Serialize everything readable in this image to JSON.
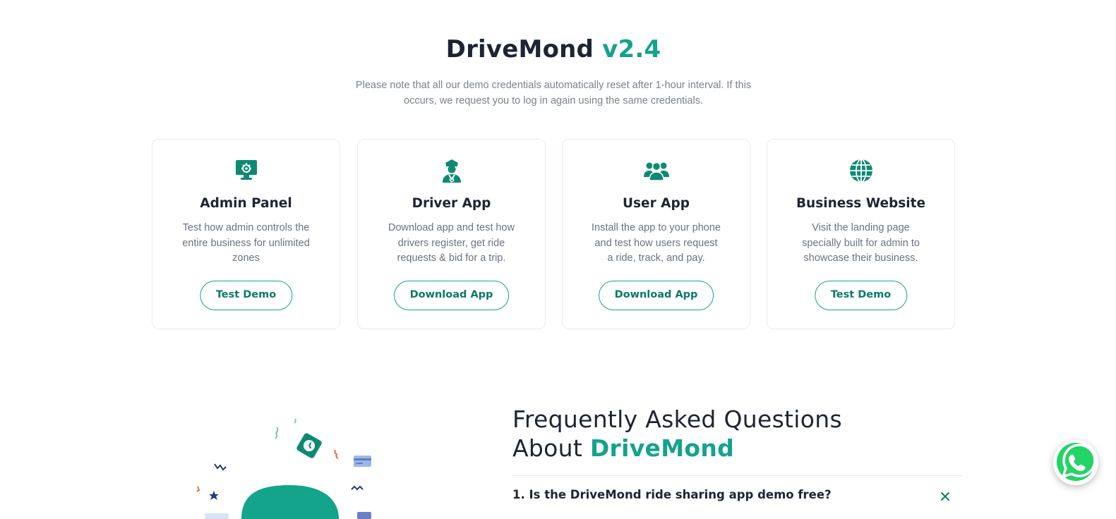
{
  "header": {
    "title_main": "DriveMond",
    "title_version": "v2.4",
    "notice": "Please note that all our demo credentials automatically reset after 1-hour interval. If this occurs, we request you to log in again using the same credentials."
  },
  "cards": [
    {
      "title": "Admin Panel",
      "desc": "Test how admin controls the entire business for unlimited zones",
      "button": "Test Demo",
      "icon": "admin-monitor-gear-icon"
    },
    {
      "title": "Driver App",
      "desc": "Download app and test how drivers register, get ride requests & bid for a trip.",
      "button": "Download App",
      "icon": "driver-person-icon"
    },
    {
      "title": "User App",
      "desc": "Install the app to your phone and test how users request a ride, track, and pay.",
      "button": "Download App",
      "icon": "users-group-icon"
    },
    {
      "title": "Business Website",
      "desc": "Visit the landing page specially built for admin to showcase their business.",
      "button": "Test Demo",
      "icon": "globe-icon"
    }
  ],
  "faq": {
    "title_line1": "Frequently Asked Questions",
    "title_line2_prefix": "About ",
    "title_brand": "DriveMond",
    "question_1": "1. Is the DriveMond ride sharing app demo free?",
    "toggle_icon": "close-icon"
  },
  "floating": {
    "whatsapp_icon": "whatsapp-icon"
  },
  "colors": {
    "accent": "#14a38b",
    "accent_dark": "#0b7a68",
    "text": "#1e2433",
    "muted": "#7b8190"
  }
}
